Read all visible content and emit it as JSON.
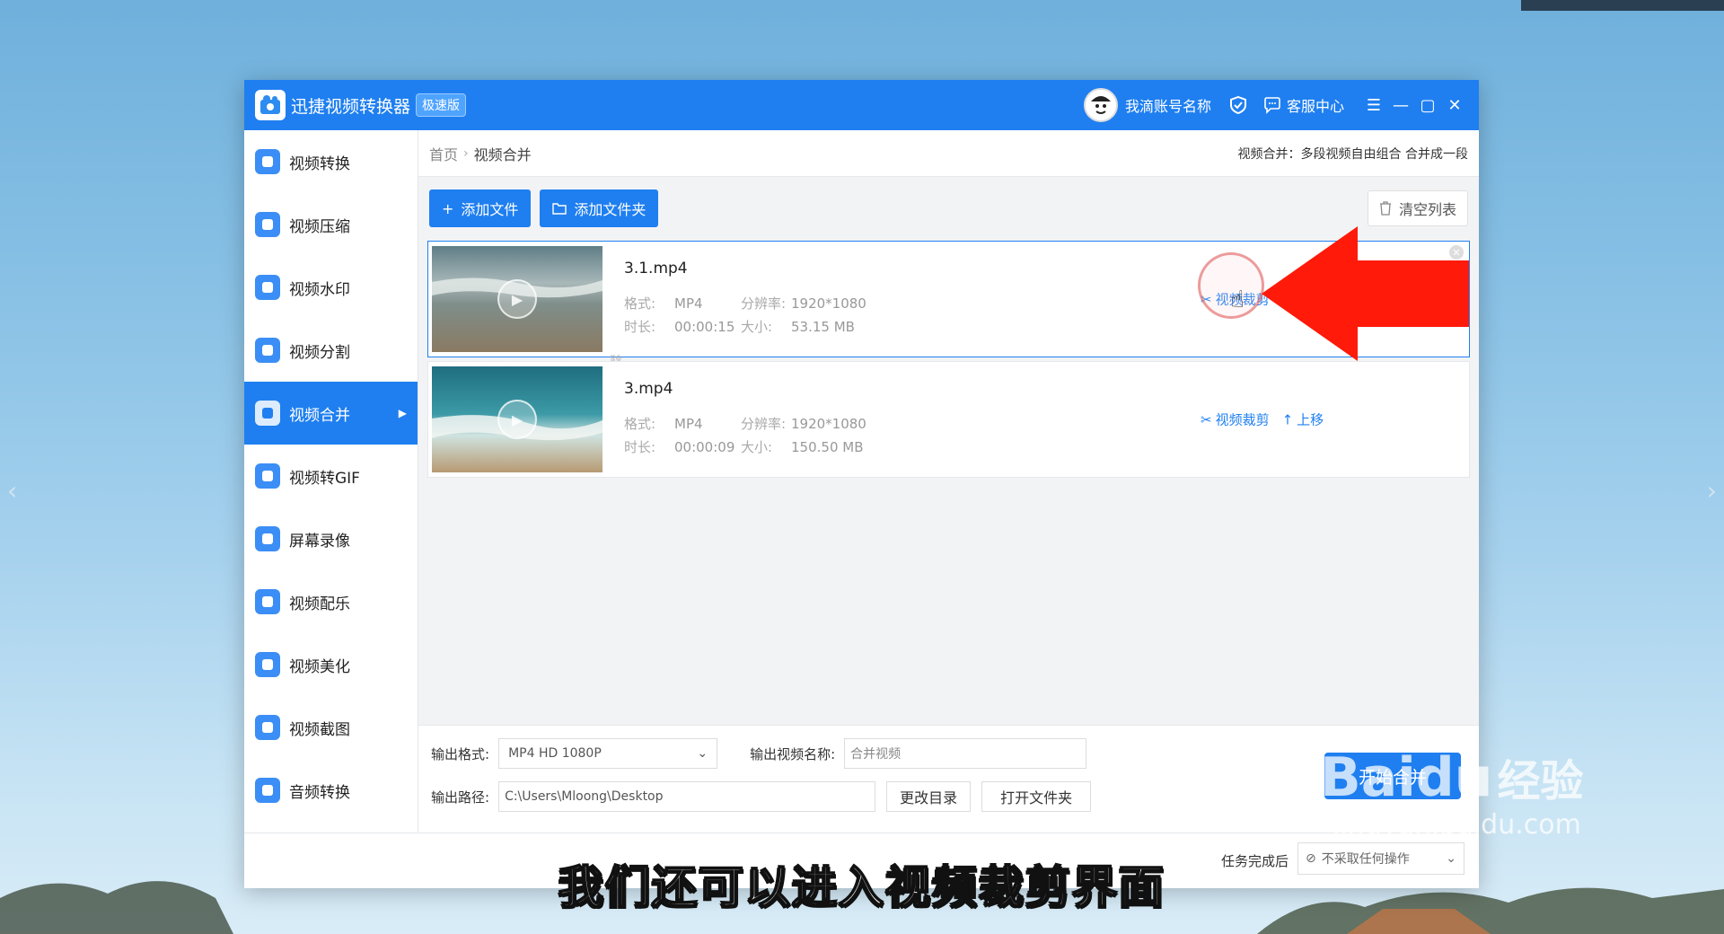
{
  "app": {
    "title": "迅捷视频转换器",
    "edition": "极速版",
    "account_name": "我滴账号名称",
    "service": "客服中心"
  },
  "sidebar": {
    "items": [
      {
        "label": "视频转换",
        "icon": "video-convert-icon",
        "color": "#3b8ef5"
      },
      {
        "label": "视频压缩",
        "icon": "video-compress-icon",
        "color": "#3b8ef5"
      },
      {
        "label": "视频水印",
        "icon": "video-watermark-icon",
        "color": "#3b8ef5"
      },
      {
        "label": "视频分割",
        "icon": "video-split-icon",
        "color": "#3b8ef5"
      },
      {
        "label": "视频合并",
        "icon": "video-merge-icon",
        "color": "#ffffff",
        "active": true
      },
      {
        "label": "视频转GIF",
        "icon": "gif-icon",
        "color": "#3b8ef5"
      },
      {
        "label": "屏幕录像",
        "icon": "screen-record-icon",
        "color": "#3b8ef5"
      },
      {
        "label": "视频配乐",
        "icon": "music-icon",
        "color": "#3b8ef5"
      },
      {
        "label": "视频美化",
        "icon": "beautify-icon",
        "color": "#3b8ef5"
      },
      {
        "label": "视频截图",
        "icon": "screenshot-icon",
        "color": "#3b8ef5"
      },
      {
        "label": "音频转换",
        "icon": "audio-convert-icon",
        "color": "#3b8ef5"
      }
    ]
  },
  "breadcrumb": {
    "home": "首页",
    "current": "视频合并",
    "description": "视频合并：多段视频自由组合 合并成一段"
  },
  "toolbar": {
    "add_file": "添加文件",
    "add_folder": "添加文件夹",
    "clear_list": "清空列表"
  },
  "files": [
    {
      "name": "3.1.mp4",
      "format_label": "格式:",
      "format": "MP4",
      "resolution_label": "分辨率:",
      "resolution": "1920*1080",
      "duration_label": "时长:",
      "duration": "00:00:15",
      "size_label": "大小:",
      "size": "53.15 MB",
      "actions": {
        "trim": "视频裁剪"
      }
    },
    {
      "name": "3.mp4",
      "format_label": "格式:",
      "format": "MP4",
      "resolution_label": "分辨率:",
      "resolution": "1920*1080",
      "duration_label": "时长:",
      "duration": "00:00:09",
      "size_label": "大小:",
      "size": "150.50 MB",
      "actions": {
        "trim": "视频裁剪",
        "move_up": "上移"
      }
    }
  ],
  "output": {
    "format_label": "输出格式:",
    "format_value": "MP4   HD 1080P",
    "name_label": "输出视频名称:",
    "name_value": "合并视频",
    "path_label": "输出路径:",
    "path_value": "C:\\Users\\Mloong\\Desktop",
    "change_dir": "更改目录",
    "open_folder": "打开文件夹",
    "start": "开始合并"
  },
  "status": {
    "after_label": "任务完成后",
    "after_value": "不采取任何操作"
  },
  "overlay": {
    "caption": "我们还可以进入视频裁剪界面",
    "watermark_main": "Baidu",
    "watermark_cn": "经验",
    "watermark_url": "jingyan.baidu.com"
  },
  "colors": {
    "accent": "#1f7ff0",
    "annotation_arrow": "#ff1a0a"
  }
}
